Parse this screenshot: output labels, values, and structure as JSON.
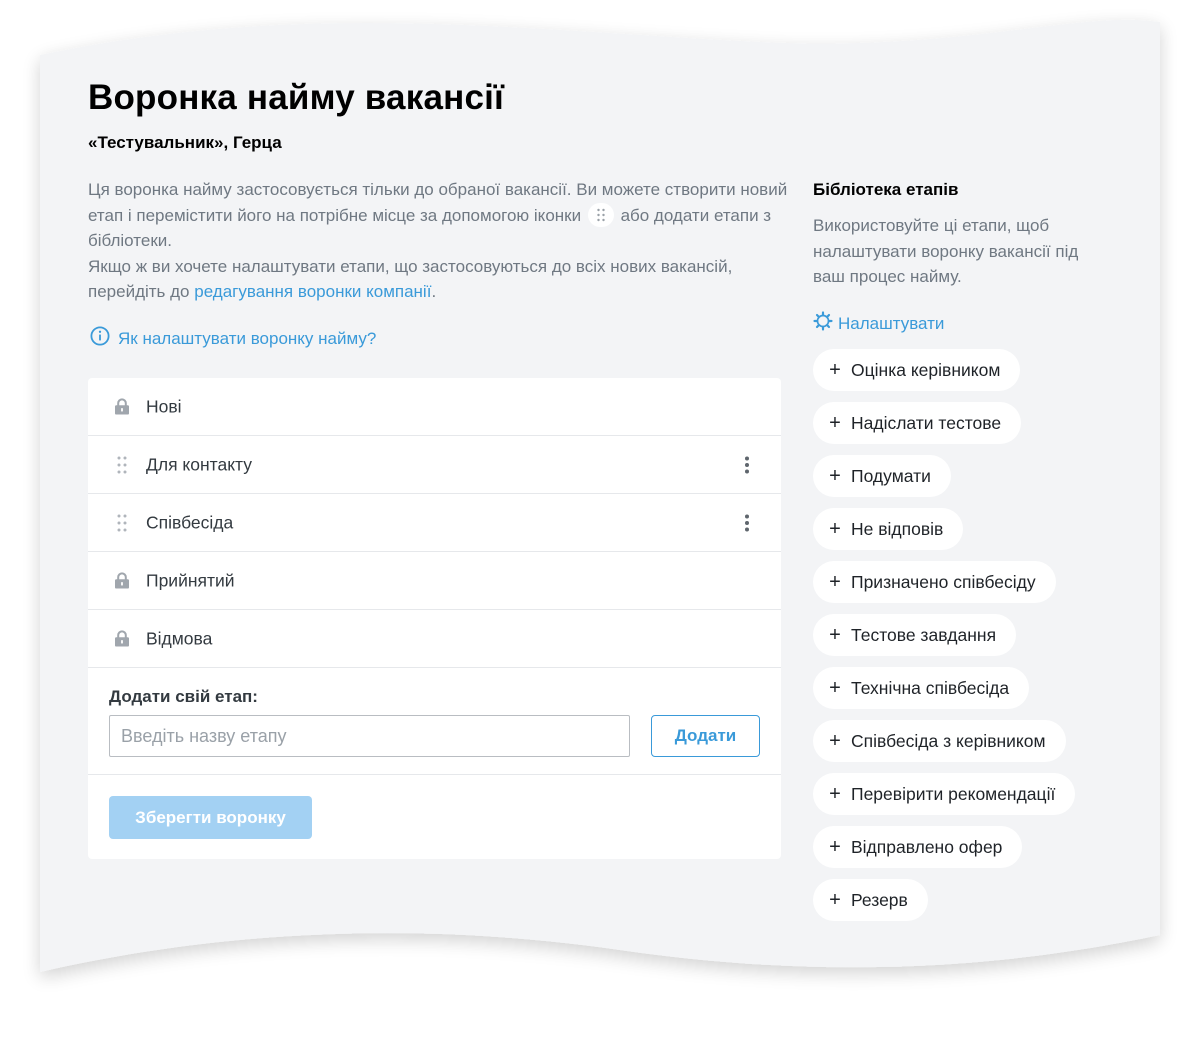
{
  "page": {
    "title": "Воронка найму вакансії",
    "subtitle": "«Тестувальник», Герца"
  },
  "intro": {
    "line1_before_icon": "Ця воронка найму застосовується тільки до обраної вакансії. Ви можете створити новий етап і перемістити його на потрібне місце за допомогою іконки",
    "line1_after_icon": "або додати етапи з бібліотеки.",
    "line2_before_link": "Якщо ж ви хочете налаштувати етапи, що застосовуються до всіх нових вакансій, перейдіть до",
    "line2_link": "редагування воронки компанії",
    "line2_after_link": "."
  },
  "help_link": {
    "label": "Як налаштувати воронку найму?",
    "icon": "info-circle-icon"
  },
  "stages": [
    {
      "label": "Нові",
      "icon": "lock-icon",
      "locked": true
    },
    {
      "label": "Для контакту",
      "icon": "drag-handle-icon",
      "locked": false
    },
    {
      "label": "Співбесіда",
      "icon": "drag-handle-icon",
      "locked": false
    },
    {
      "label": "Прийнятий",
      "icon": "lock-icon",
      "locked": true
    },
    {
      "label": "Відмова",
      "icon": "lock-icon",
      "locked": true
    }
  ],
  "add_stage": {
    "label": "Додати свій етап:",
    "placeholder": "Введіть назву етапу",
    "value": "",
    "button": "Додати"
  },
  "save_button": "Зберегти воронку",
  "library": {
    "title": "Бібліотека етапів",
    "description": "Використовуйте ці етапи, щоб налаштувати воронку вакансії під ваш процес найму.",
    "configure_label": "Налаштувати",
    "configure_icon": "gear-icon",
    "items": [
      "Оцінка керівником",
      "Надіслати тестове",
      "Подумати",
      "Не відповів",
      "Призначено співбесіду",
      "Тестове завдання",
      "Технічна співбесіда",
      "Співбесіда з керівником",
      "Перевірити рекомендації",
      "Відправлено офер",
      "Резерв"
    ]
  },
  "colors": {
    "accent": "#3a9ad9",
    "sheet_background": "#f3f4f6",
    "muted_text": "#6f7882",
    "save_disabled": "#a3d1f3"
  }
}
